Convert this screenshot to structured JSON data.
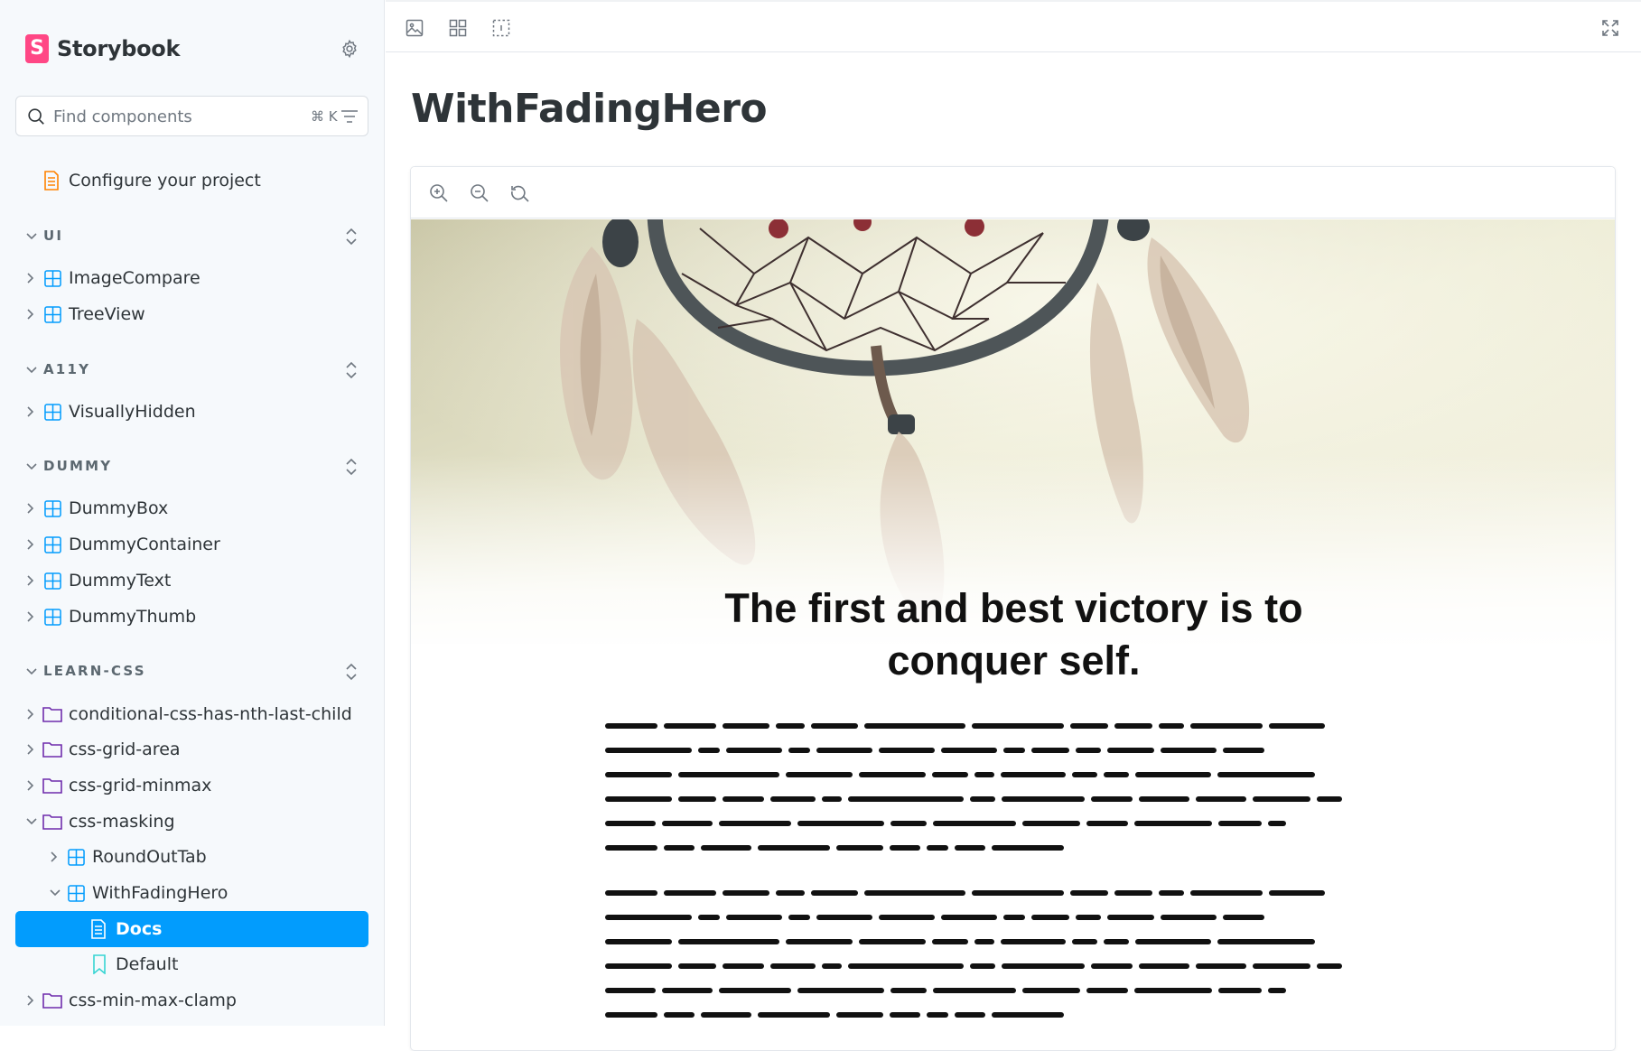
{
  "brand": {
    "name": "Storybook",
    "logo_letter": "S"
  },
  "search": {
    "placeholder": "Find components",
    "shortcut": "⌘ K"
  },
  "sidebar": {
    "configure": "Configure your project",
    "groups": [
      {
        "label": "UI",
        "items": [
          "ImageCompare",
          "TreeView"
        ]
      },
      {
        "label": "A11Y",
        "items": [
          "VisuallyHidden"
        ]
      },
      {
        "label": "DUMMY",
        "items": [
          "DummyBox",
          "DummyContainer",
          "DummyText",
          "DummyThumb"
        ]
      },
      {
        "label": "LEARN-CSS",
        "items": [
          "conditional-css-has-nth-last-child",
          "css-grid-area",
          "css-grid-minmax",
          "css-masking",
          "RoundOutTab",
          "WithFadingHero",
          "Docs",
          "Default",
          "css-min-max-clamp"
        ]
      }
    ]
  },
  "main": {
    "title": "WithFadingHero",
    "quote_line1": "The first and best victory is to",
    "quote_line2": "conquer self."
  },
  "colors": {
    "accent": "#029cfd",
    "brand": "#ff4785",
    "component_icon": "#029cfd",
    "folder_icon": "#6f2cac",
    "doc_icon": "#ff8300",
    "story_icon": "#37d5d3"
  },
  "icons": {
    "toolbar": [
      "image-icon",
      "grid-icon",
      "outline-icon"
    ],
    "fullscreen": "expand-icon",
    "zoom": [
      "zoom-in-icon",
      "zoom-out-icon",
      "zoom-reset-icon"
    ]
  }
}
